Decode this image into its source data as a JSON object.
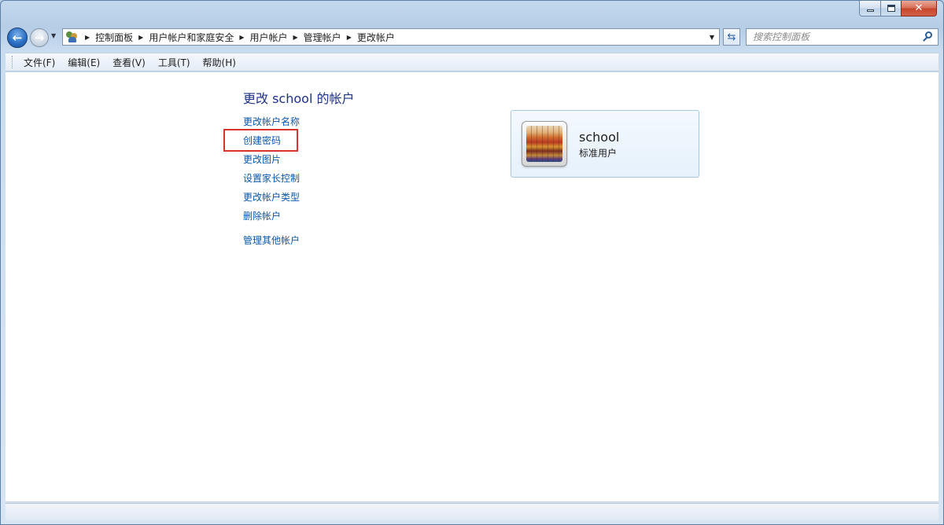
{
  "window": {
    "caption": {
      "minimize_glyph": "minimize-icon",
      "maximize_glyph": "maximize-icon",
      "close_glyph": "✕"
    }
  },
  "nav": {
    "back_glyph": "←",
    "forward_glyph": "→",
    "breadcrumbs": [
      "控制面板",
      "用户帐户和家庭安全",
      "用户帐户",
      "管理帐户",
      "更改帐户"
    ],
    "search_placeholder": "搜索控制面板"
  },
  "menubar": {
    "items": [
      "文件(F)",
      "编辑(E)",
      "查看(V)",
      "工具(T)",
      "帮助(H)"
    ]
  },
  "main": {
    "title": "更改 school 的帐户",
    "tasks": [
      "更改帐户名称",
      "创建密码",
      "更改图片",
      "设置家长控制",
      "更改帐户类型",
      "删除帐户"
    ],
    "other_link": "管理其他帐户",
    "highlighted_task": "创建密码",
    "highlight_color": "#d9332c",
    "link_color": "#0b57a8",
    "title_color": "#1e3287"
  },
  "account": {
    "name": "school",
    "type": "标准用户"
  }
}
